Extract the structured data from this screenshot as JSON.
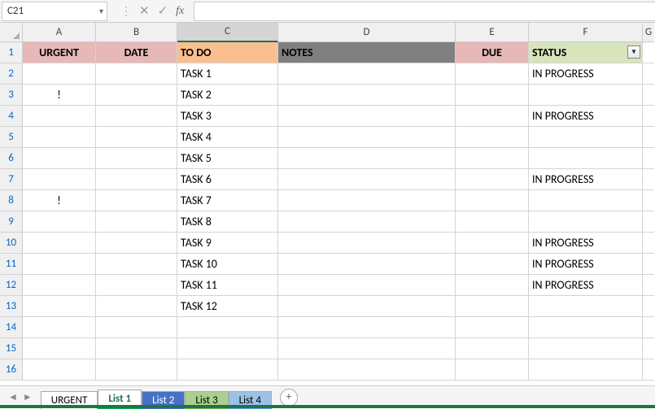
{
  "namebox": {
    "value": "C21"
  },
  "fx_label": "fx",
  "columns": [
    "A",
    "B",
    "C",
    "D",
    "E",
    "F",
    "G"
  ],
  "selected_col": "C",
  "row_numbers": [
    1,
    2,
    3,
    4,
    5,
    6,
    7,
    8,
    9,
    10,
    11,
    12,
    13,
    14,
    15,
    16
  ],
  "header": {
    "A": "URGENT",
    "B": "DATE",
    "C": "TO DO",
    "D": "NOTES",
    "E": "DUE",
    "F": "STATUS"
  },
  "rows": [
    {
      "urgent": "",
      "date": "",
      "todo": "TASK 1",
      "notes": "",
      "due": "",
      "status": "IN PROGRESS"
    },
    {
      "urgent": "!",
      "date": "",
      "todo": "TASK 2",
      "notes": "",
      "due": "",
      "status": ""
    },
    {
      "urgent": "",
      "date": "",
      "todo": "TASK 3",
      "notes": "",
      "due": "",
      "status": "IN PROGRESS"
    },
    {
      "urgent": "",
      "date": "",
      "todo": "TASK 4",
      "notes": "",
      "due": "",
      "status": ""
    },
    {
      "urgent": "",
      "date": "",
      "todo": "TASK 5",
      "notes": "",
      "due": "",
      "status": ""
    },
    {
      "urgent": "",
      "date": "",
      "todo": "TASK 6",
      "notes": "",
      "due": "",
      "status": "IN PROGRESS"
    },
    {
      "urgent": "!",
      "date": "",
      "todo": "TASK 7",
      "notes": "",
      "due": "",
      "status": ""
    },
    {
      "urgent": "",
      "date": "",
      "todo": "TASK 8",
      "notes": "",
      "due": "",
      "status": ""
    },
    {
      "urgent": "",
      "date": "",
      "todo": "TASK 9",
      "notes": "",
      "due": "",
      "status": "IN PROGRESS"
    },
    {
      "urgent": "",
      "date": "",
      "todo": "TASK 10",
      "notes": "",
      "due": "",
      "status": "IN PROGRESS"
    },
    {
      "urgent": "",
      "date": "",
      "todo": "TASK 11",
      "notes": "",
      "due": "",
      "status": "IN PROGRESS"
    },
    {
      "urgent": "",
      "date": "",
      "todo": "TASK 12",
      "notes": "",
      "due": "",
      "status": ""
    },
    {
      "urgent": "",
      "date": "",
      "todo": "",
      "notes": "",
      "due": "",
      "status": ""
    },
    {
      "urgent": "",
      "date": "",
      "todo": "",
      "notes": "",
      "due": "",
      "status": ""
    },
    {
      "urgent": "",
      "date": "",
      "todo": "",
      "notes": "",
      "due": "",
      "status": ""
    }
  ],
  "sheet_tabs": [
    {
      "label": "URGENT",
      "style": "plain"
    },
    {
      "label": "List 1",
      "style": "active"
    },
    {
      "label": "List 2",
      "style": "c-blue"
    },
    {
      "label": "List 3",
      "style": "c-green"
    },
    {
      "label": "List 4",
      "style": "c-teal"
    }
  ],
  "filter_glyph": "▾"
}
